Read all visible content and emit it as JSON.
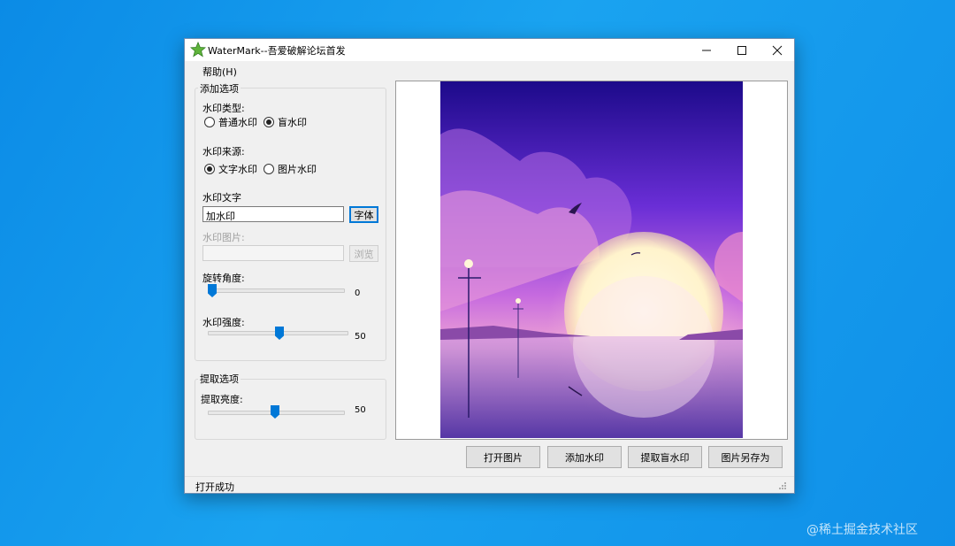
{
  "window": {
    "title": "WaterMark--吾爱破解论坛首发",
    "minimize_icon": "minimize-icon",
    "maximize_icon": "maximize-icon",
    "close_icon": "close-icon"
  },
  "menu": {
    "help": "帮助(H)"
  },
  "add_options": {
    "group_title": "添加选项",
    "type_label": "水印类型:",
    "type_options": [
      {
        "label": "普通水印",
        "selected": false
      },
      {
        "label": "盲水印",
        "selected": true
      }
    ],
    "source_label": "水印来源:",
    "source_options": [
      {
        "label": "文字水印",
        "selected": true
      },
      {
        "label": "图片水印",
        "selected": false
      }
    ],
    "text_label": "水印文字",
    "text_value": "加水印",
    "font_button": "字体",
    "image_label": "水印图片:",
    "image_value": "",
    "browse_button": "浏览",
    "rotation_label": "旋转角度:",
    "rotation_value": "0",
    "rotation_fraction": 0.0,
    "strength_label": "水印强度:",
    "strength_value": "50",
    "strength_fraction": 0.5
  },
  "extract_options": {
    "group_title": "提取选项",
    "brightness_label": "提取亮度:",
    "brightness_value": "50",
    "brightness_fraction": 0.5
  },
  "buttons": {
    "open_image": "打开图片",
    "add_watermark": "添加水印",
    "extract_blind": "提取盲水印",
    "save_as": "图片另存为"
  },
  "status": {
    "text": "打开成功"
  },
  "desktop_watermark": "@稀土掘金技术社区",
  "colors": {
    "accent": "#0078d7",
    "desktop": "#1aa3f0"
  }
}
